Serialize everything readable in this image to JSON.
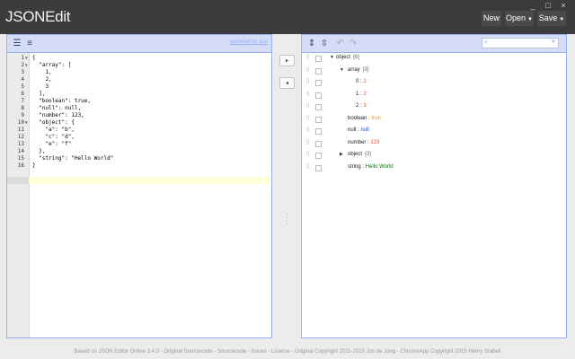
{
  "app": {
    "title": "JSONEdit",
    "window_controls": [
      "_",
      "□",
      "×"
    ],
    "buttons": {
      "new": "New",
      "open": "Open",
      "save": "Save"
    }
  },
  "left_panel": {
    "powered_by": "powered by ace",
    "code_lines": [
      "{",
      "  \"array\": [",
      "    1,",
      "    2,",
      "    3",
      "  ],",
      "  \"boolean\": true,",
      "  \"null\": null,",
      "  \"number\": 123,",
      "  \"object\": {",
      "    \"a\": \"b\",",
      "    \"c\": \"d\",",
      "    \"e\": \"f\"",
      "  },",
      "  \"string\": \"Hello World\"",
      "}"
    ],
    "line_numbers": [
      "1",
      "2",
      "3",
      "4",
      "5",
      "6",
      "7",
      "8",
      "9",
      "10",
      "11",
      "12",
      "13",
      "14",
      "15",
      "16"
    ]
  },
  "middle": {
    "to_right": "▸",
    "to_left": "◂"
  },
  "right_panel": {
    "tree": [
      {
        "key": "object",
        "meta": "{6}",
        "toggle": "▼",
        "depth": 0
      },
      {
        "key": "array",
        "meta": "[3]",
        "toggle": "▼",
        "depth": 1
      },
      {
        "key": "0",
        "value": "1",
        "type": "num",
        "depth": 2
      },
      {
        "key": "1",
        "value": "2",
        "type": "num",
        "depth": 2
      },
      {
        "key": "2",
        "value": "3",
        "type": "num",
        "depth": 2
      },
      {
        "key": "boolean",
        "value": "true",
        "type": "bool",
        "depth": 1
      },
      {
        "key": "null",
        "value": "null",
        "type": "null",
        "depth": 1
      },
      {
        "key": "number",
        "value": "123",
        "type": "num",
        "depth": 1
      },
      {
        "key": "object",
        "meta": "{3}",
        "toggle": "▶",
        "depth": 1
      },
      {
        "key": "string",
        "value": "Hello World",
        "type": "str",
        "depth": 1
      }
    ]
  },
  "footer": "Based on JSON Editor Online 3.4.0 - Original Sourcecode - Sourcecode - Issues - License - Original Copyright 2011-2015 Jos de Jong - ChromeApp Copyright 2015 Henry Stabell"
}
